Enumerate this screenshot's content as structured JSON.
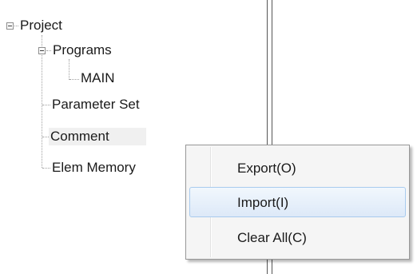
{
  "tree": {
    "root_label": "Project",
    "programs_label": "Programs",
    "main_label": "MAIN",
    "parameter_set_label": "Parameter Set",
    "comment_label": "Comment",
    "elem_memory_label": "Elem Memory"
  },
  "context_menu": {
    "items": [
      {
        "label": "Export(O)"
      },
      {
        "label": "Import(I)"
      },
      {
        "label": "Clear All(C)"
      }
    ],
    "hovered_index": 1
  }
}
